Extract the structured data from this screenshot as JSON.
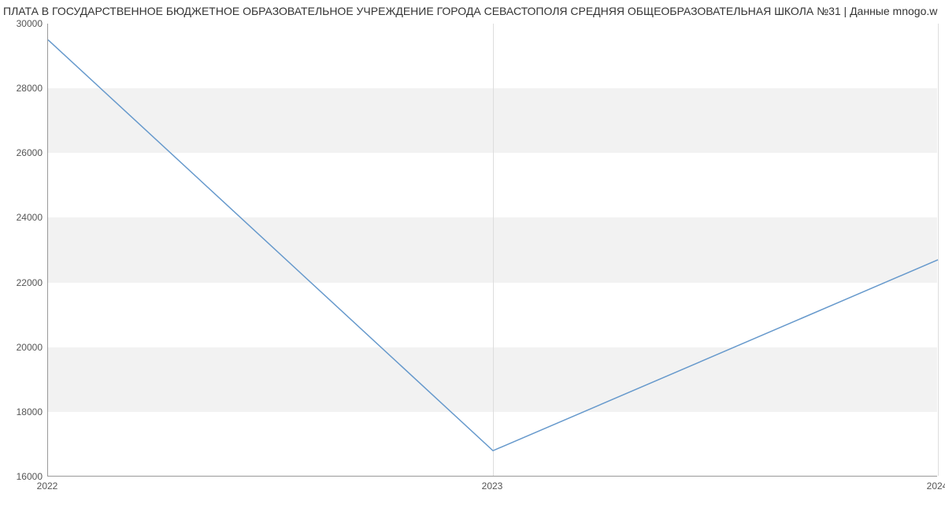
{
  "chart_data": {
    "type": "line",
    "title": "ПЛАТА В ГОСУДАРСТВЕННОЕ БЮДЖЕТНОЕ ОБРАЗОВАТЕЛЬНОЕ УЧРЕЖДЕНИЕ ГОРОДА СЕВАСТОПОЛЯ СРЕДНЯЯ ОБЩЕОБРАЗОВАТЕЛЬНАЯ ШКОЛА №31 | Данные mnogo.w",
    "xlabel": "",
    "ylabel": "",
    "x": [
      2022,
      2023,
      2024
    ],
    "values": [
      29500,
      16800,
      22700
    ],
    "x_ticks": [
      2022,
      2023,
      2024
    ],
    "y_ticks": [
      16000,
      18000,
      20000,
      22000,
      24000,
      26000,
      28000,
      30000
    ],
    "xlim": [
      2022,
      2024
    ],
    "ylim": [
      16000,
      30000
    ],
    "grid": "horizontal-bands",
    "line_color": "#6699cc"
  }
}
